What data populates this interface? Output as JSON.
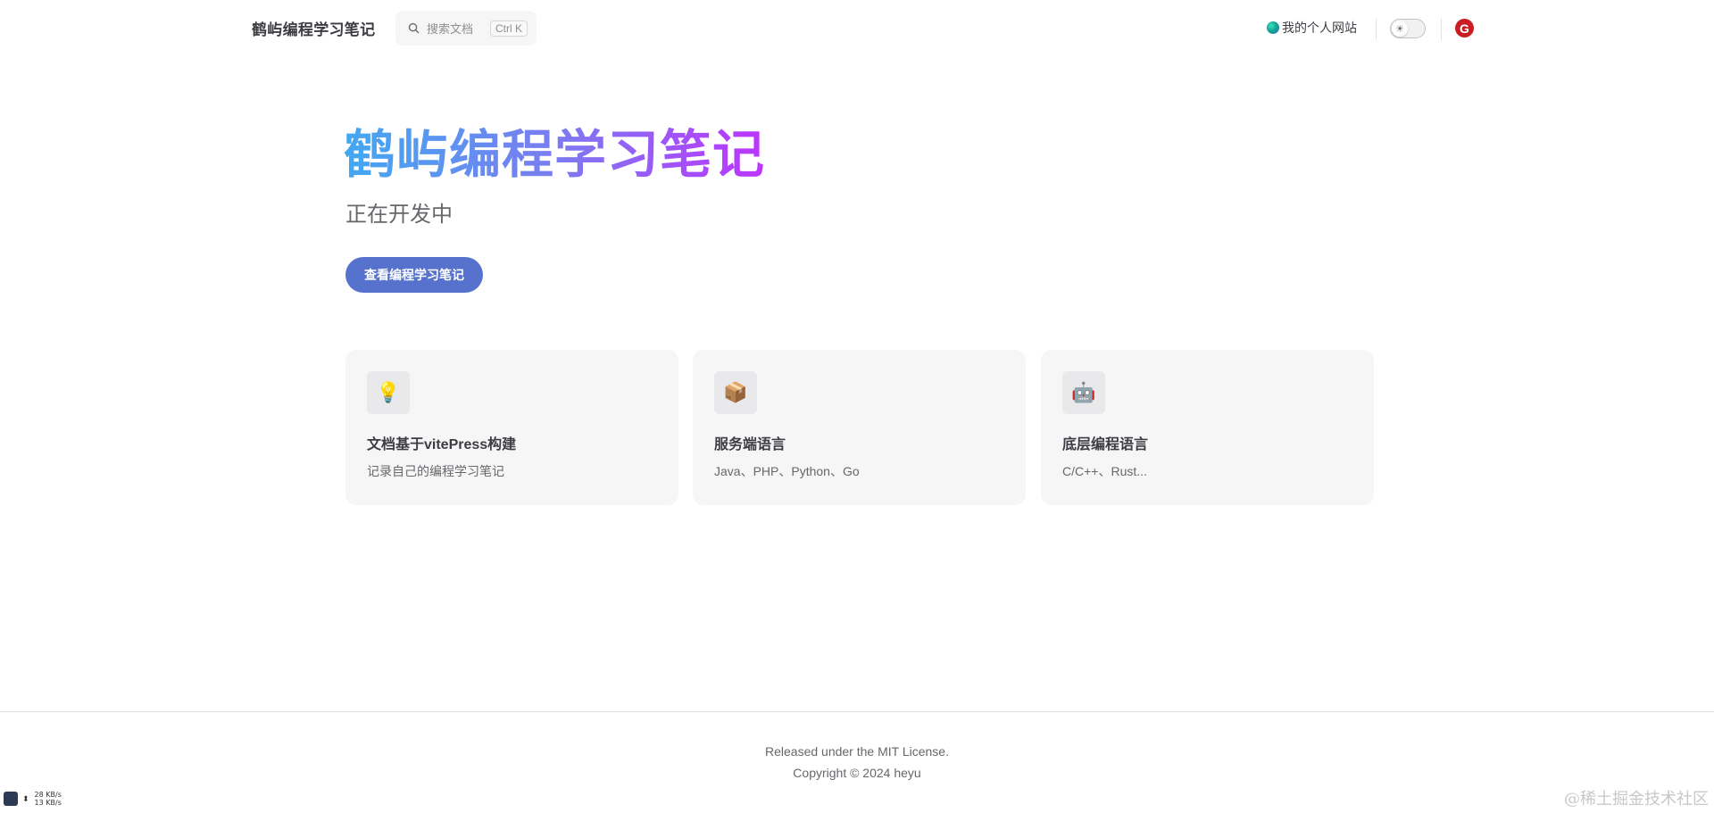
{
  "nav": {
    "brand": "鹤屿编程学习笔记",
    "search": {
      "placeholder": "搜索文档",
      "shortcut": "Ctrl K",
      "icon": "search-icon"
    },
    "site_link": "我的个人网站",
    "theme_toggle_icon": "sun-icon",
    "gitee_label": "G"
  },
  "hero": {
    "title": "鹤屿编程学习笔记",
    "tagline": "正在开发中",
    "action": "查看编程学习笔记",
    "title_gradient": [
      "#41a8f1",
      "#bd34fe"
    ],
    "action_color": "#5672cd"
  },
  "features": [
    {
      "icon": "💡",
      "icon_name": "lightbulb-icon",
      "title": "文档基于vitePress构建",
      "details": "记录自己的编程学习笔记"
    },
    {
      "icon": "📦",
      "icon_name": "package-icon",
      "title": "服务端语言",
      "details": "Java、PHP、Python、Go"
    },
    {
      "icon": "🤖",
      "icon_name": "robot-icon",
      "title": "底层编程语言",
      "details": "C/C++、Rust..."
    }
  ],
  "footer": {
    "message": "Released under the MIT License.",
    "copyright": "Copyright © 2024 heyu"
  },
  "overlay": {
    "net_up": "28 KB/s",
    "net_down": "13 KB/s",
    "watermark": "@稀土掘金技术社区"
  }
}
